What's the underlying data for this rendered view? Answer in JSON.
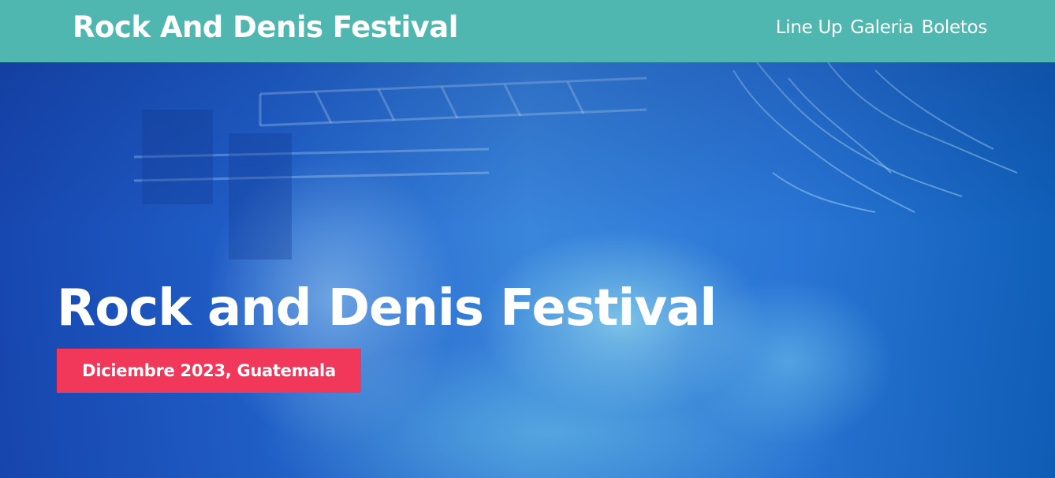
{
  "header": {
    "brand": "Rock And Denis Festival",
    "nav": [
      {
        "label": "Line Up"
      },
      {
        "label": "Galeria"
      },
      {
        "label": "Boletos"
      }
    ]
  },
  "hero": {
    "title": "Rock and Denis Festival",
    "date_location": "Diciembre 2023, Guatemala"
  },
  "colors": {
    "header_bg": "#4fb7b0",
    "badge_bg": "#f2385a",
    "hero_blue": "#2a76d6"
  }
}
